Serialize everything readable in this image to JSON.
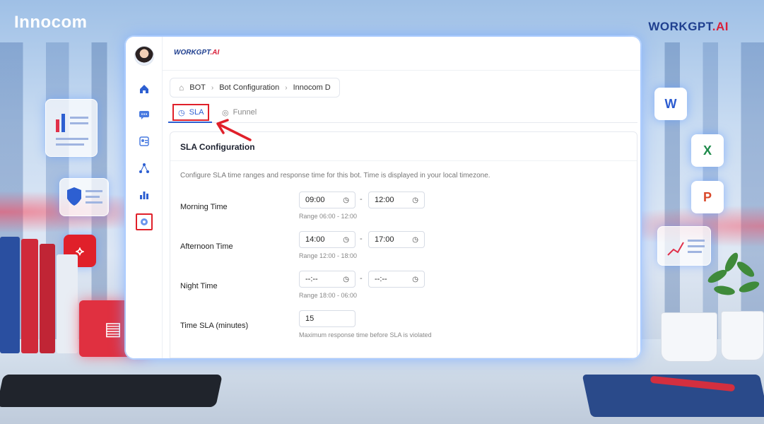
{
  "branding": {
    "left_logo": "Innocom",
    "right_logo_main": "WORKGPT",
    "right_logo_suffix": ".AI",
    "app_logo_main": "WORKGPT",
    "app_logo_suffix": ".AI"
  },
  "breadcrumb": {
    "items": [
      "BOT",
      "Bot Configuration",
      "Innocom D"
    ]
  },
  "tabs": [
    {
      "label": "SLA",
      "active": true
    },
    {
      "label": "Funnel",
      "active": false
    }
  ],
  "panel": {
    "title": "SLA Configuration",
    "description": "Configure SLA time ranges and response time for this bot. Time is displayed in your local timezone."
  },
  "rows": {
    "morning": {
      "label": "Morning Time",
      "start": "09:00",
      "end": "12:00",
      "hint": "Range 06:00 - 12:00"
    },
    "afternoon": {
      "label": "Afternoon Time",
      "start": "14:00",
      "end": "17:00",
      "hint": "Range 12:00 - 18:00"
    },
    "night": {
      "label": "Night Time",
      "start": "--:--",
      "end": "--:--",
      "hint": "Range 18:00 - 06:00"
    },
    "sla": {
      "label": "Time SLA (minutes)",
      "value": "15",
      "hint": "Maximum response time before SLA is violated"
    }
  },
  "separators": {
    "dash": "-"
  },
  "icons": {
    "sidebar": [
      "home-icon",
      "chat-icon",
      "contact-icon",
      "network-icon",
      "chart-icon",
      "settings-icon"
    ],
    "tab_sla": "clock-icon",
    "tab_funnel": "funnel-icon"
  },
  "colors": {
    "accent": "#2d5fd1",
    "highlight": "#e0202a"
  }
}
